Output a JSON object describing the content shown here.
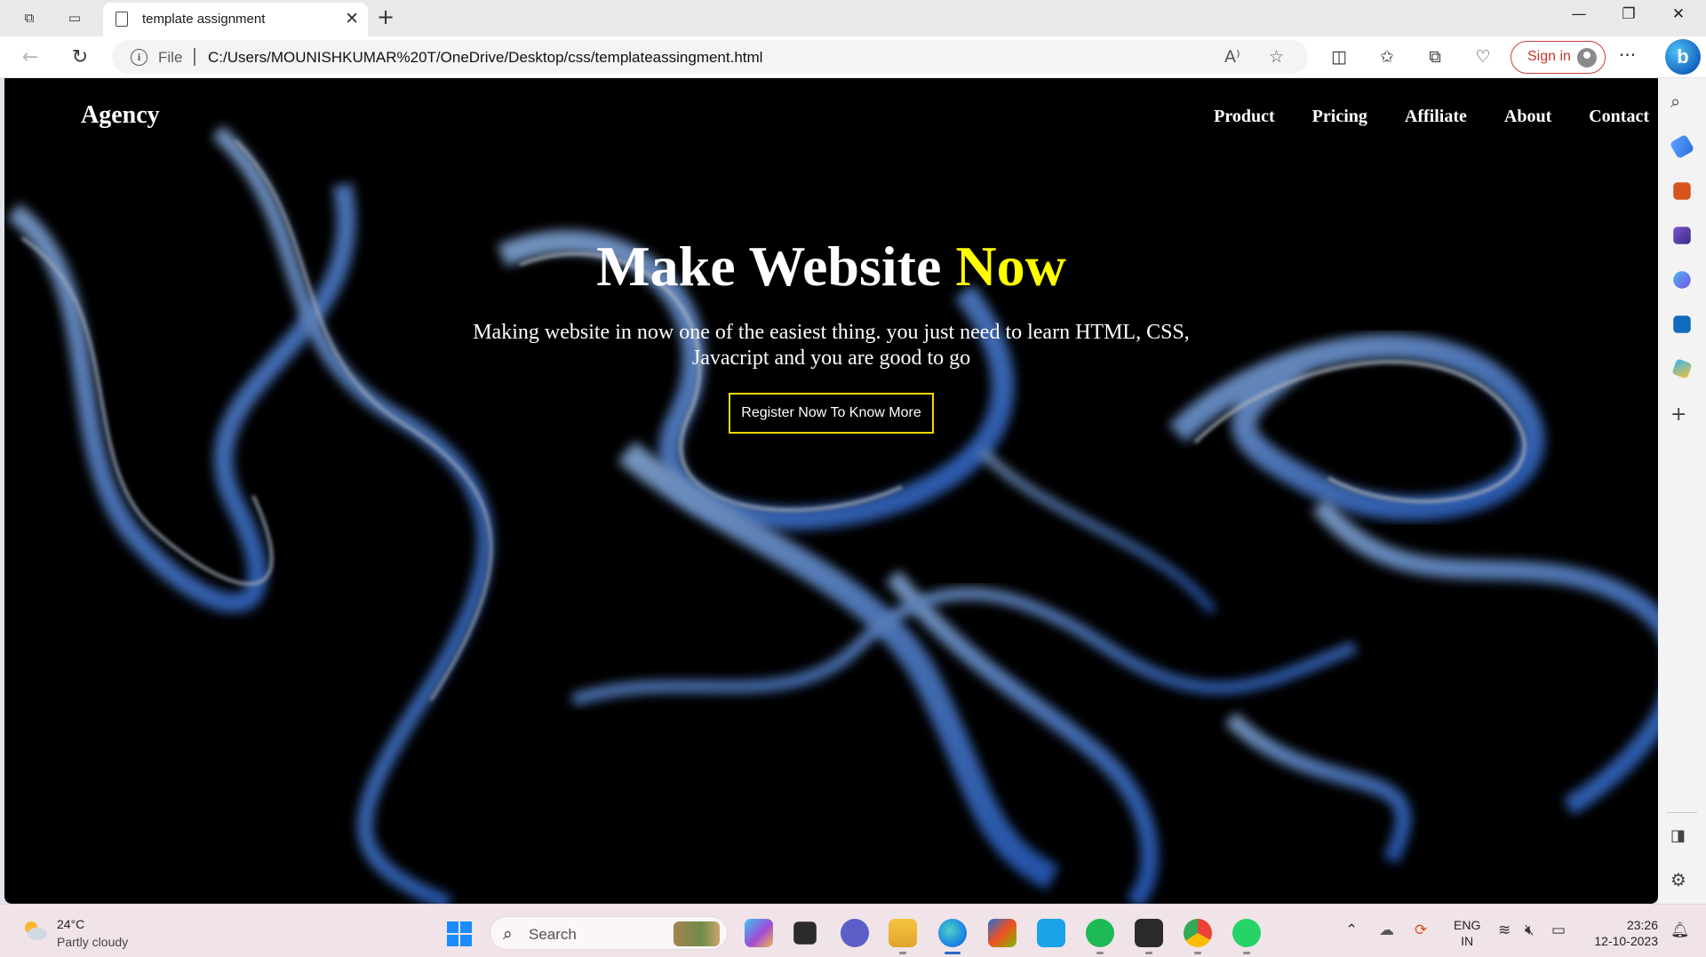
{
  "browser": {
    "tab": {
      "title": "template assignment"
    },
    "address": {
      "scheme_label": "File",
      "url": "C:/Users/MOUNISHKUMAR%20T/OneDrive/Desktop/css/templateassingment.html"
    },
    "signin_label": "Sign in"
  },
  "page": {
    "brand": "Agency",
    "menu": [
      "Product",
      "Pricing",
      "Affiliate",
      "About",
      "Contact"
    ],
    "hero": {
      "title_main": "Make Website",
      "title_highlight": "Now",
      "subtitle": "Making website in now one of the easiest thing. you just need to learn HTML, CSS, Javacript and you are good to go",
      "button_label": "Register Now To Know More"
    },
    "colors": {
      "highlight": "#ffff00",
      "button_border": "#f5d800",
      "background": "#000000"
    }
  },
  "taskbar": {
    "weather": {
      "temp": "24°C",
      "desc": "Partly cloudy"
    },
    "search_label": "Search",
    "language": {
      "line1": "ENG",
      "line2": "IN"
    },
    "clock": {
      "time": "23:26",
      "date": "12-10-2023"
    }
  }
}
